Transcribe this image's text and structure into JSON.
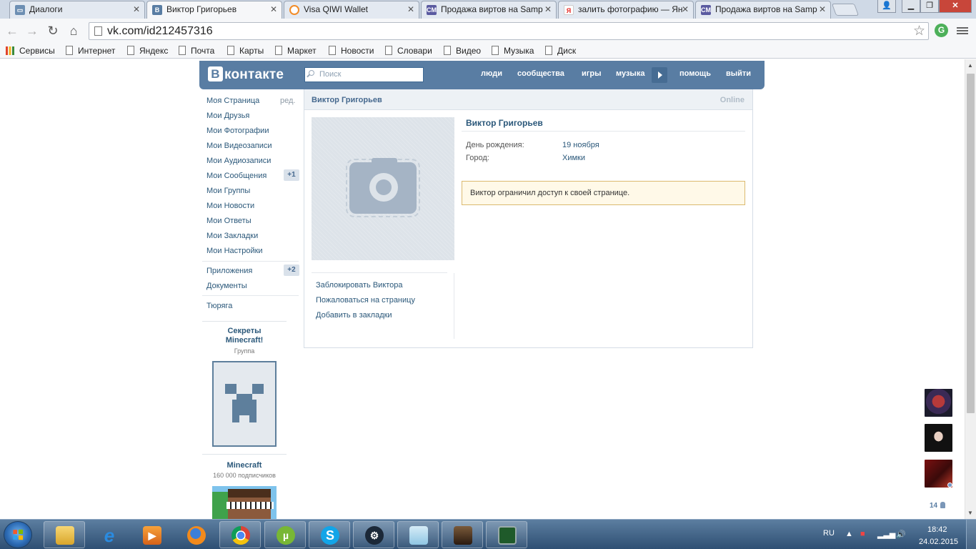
{
  "browser": {
    "tabs": [
      {
        "title": "Диалоги",
        "favicon": "vk-messages-icon"
      },
      {
        "title": "Виктор Григорьев",
        "favicon": "vk-icon"
      },
      {
        "title": "Visa QIWI Wallet",
        "favicon": "qiwi-icon"
      },
      {
        "title": "Продажа виртов на Samp",
        "favicon": "cm-icon"
      },
      {
        "title": "залить фотографию — Ян",
        "favicon": "yandex-icon"
      },
      {
        "title": "Продажа виртов на Samp",
        "favicon": "cm-icon"
      }
    ],
    "url": "vk.com/id212457316",
    "bookmarks": [
      "Сервисы",
      "Интернет",
      "Яндекс",
      "Почта",
      "Карты",
      "Маркет",
      "Новости",
      "Словари",
      "Видео",
      "Музыка",
      "Диск"
    ]
  },
  "vk": {
    "logo": "контакте",
    "logo_letter": "В",
    "search_placeholder": "Поиск",
    "nav": [
      "люди",
      "сообщества",
      "игры",
      "музыка",
      "помощь",
      "выйти"
    ],
    "left_menu": [
      {
        "label": "Моя Страница",
        "extra": "ред."
      },
      {
        "label": "Мои Друзья"
      },
      {
        "label": "Мои Фотографии"
      },
      {
        "label": "Мои Видеозаписи"
      },
      {
        "label": "Мои Аудиозаписи"
      },
      {
        "label": "Мои Сообщения",
        "badge": "+1"
      },
      {
        "label": "Мои Группы"
      },
      {
        "label": "Мои Новости"
      },
      {
        "label": "Мои Ответы"
      },
      {
        "label": "Мои Закладки"
      },
      {
        "label": "Мои Настройки"
      },
      {
        "label": "Приложения",
        "badge": "+2"
      },
      {
        "label": "Документы"
      },
      {
        "label": "Тюряга"
      }
    ],
    "ads": [
      {
        "title": "Секреты Minecraft!",
        "subtitle": "Группа"
      },
      {
        "title": "Minecraft",
        "subtitle": "160 000 подписчиков"
      }
    ],
    "profile": {
      "header_name": "Виктор Григорьев",
      "status": "Online",
      "name": "Виктор Григорьев",
      "fields": [
        {
          "label": "День рождения:",
          "value": "19 ноября"
        },
        {
          "label": "Город:",
          "value": "Химки"
        }
      ],
      "restricted_notice": "Виктор ограничил доступ к своей странице.",
      "actions": [
        "Заблокировать Виктора",
        "Пожаловаться на страницу",
        "Добавить в закладки"
      ]
    },
    "online_friends_count": "14"
  },
  "taskbar": {
    "lang": "RU",
    "time": "18:42",
    "date": "24.02.2015"
  },
  "colors": {
    "vk_header": "#597da3",
    "vk_link": "#2b587a",
    "notice_bg": "#fff9e8",
    "notice_border": "#dbb96f"
  }
}
